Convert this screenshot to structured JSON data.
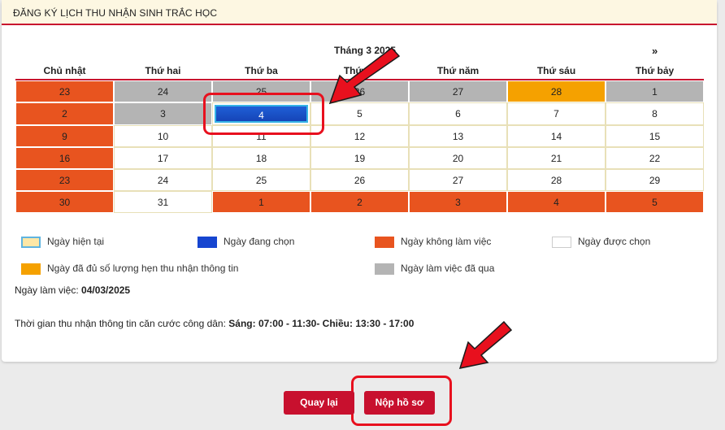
{
  "header": {
    "title": "ĐĂNG KÝ LỊCH THU NHẬN SINH TRẮC HỌC"
  },
  "calendar": {
    "month_title": "Tháng 3 2025",
    "next_label": "»",
    "weekdays": [
      "Chủ nhật",
      "Thứ hai",
      "Thứ ba",
      "Thứ tư",
      "Thứ năm",
      "Thứ sáu",
      "Thứ bảy"
    ],
    "weeks": [
      [
        {
          "d": "23",
          "t": "off"
        },
        {
          "d": "24",
          "t": "past"
        },
        {
          "d": "25",
          "t": "past"
        },
        {
          "d": "26",
          "t": "past"
        },
        {
          "d": "27",
          "t": "past"
        },
        {
          "d": "28",
          "t": "full"
        },
        {
          "d": "1",
          "t": "past"
        }
      ],
      [
        {
          "d": "2",
          "t": "off"
        },
        {
          "d": "3",
          "t": "past"
        },
        {
          "d": "4",
          "t": "sel"
        },
        {
          "d": "5",
          "t": "free"
        },
        {
          "d": "6",
          "t": "free"
        },
        {
          "d": "7",
          "t": "free"
        },
        {
          "d": "8",
          "t": "free"
        }
      ],
      [
        {
          "d": "9",
          "t": "off"
        },
        {
          "d": "10",
          "t": "free"
        },
        {
          "d": "11",
          "t": "free"
        },
        {
          "d": "12",
          "t": "free"
        },
        {
          "d": "13",
          "t": "free"
        },
        {
          "d": "14",
          "t": "free"
        },
        {
          "d": "15",
          "t": "free"
        }
      ],
      [
        {
          "d": "16",
          "t": "off"
        },
        {
          "d": "17",
          "t": "free"
        },
        {
          "d": "18",
          "t": "free"
        },
        {
          "d": "19",
          "t": "free"
        },
        {
          "d": "20",
          "t": "free"
        },
        {
          "d": "21",
          "t": "free"
        },
        {
          "d": "22",
          "t": "free"
        }
      ],
      [
        {
          "d": "23",
          "t": "off"
        },
        {
          "d": "24",
          "t": "free"
        },
        {
          "d": "25",
          "t": "free"
        },
        {
          "d": "26",
          "t": "free"
        },
        {
          "d": "27",
          "t": "free"
        },
        {
          "d": "28",
          "t": "free"
        },
        {
          "d": "29",
          "t": "free"
        }
      ],
      [
        {
          "d": "30",
          "t": "off"
        },
        {
          "d": "31",
          "t": "free"
        },
        {
          "d": "1",
          "t": "off"
        },
        {
          "d": "2",
          "t": "off"
        },
        {
          "d": "3",
          "t": "off"
        },
        {
          "d": "4",
          "t": "off"
        },
        {
          "d": "5",
          "t": "off"
        }
      ]
    ]
  },
  "legend": {
    "today": "Ngày hiện tại",
    "selecting": "Ngày đang chọn",
    "non_working": "Ngày không làm việc",
    "selectable": "Ngày được chọn",
    "full": "Ngày đã đủ số lượng hẹn thu nhận thông tin",
    "past": "Ngày làm việc đã qua"
  },
  "colors": {
    "accent": "#c8102e",
    "non_working": "#e8541f",
    "past": "#b4b4b4",
    "full": "#f5a100",
    "selected": "#1645b8",
    "today": "#fde7a6"
  },
  "info": {
    "workday_label": "Ngày làm việc: ",
    "workday_value": "04/03/2025",
    "hours_label": "Thời gian thu nhận thông tin căn cước công dân: ",
    "hours_value": "Sáng: 07:00 - 11:30- Chiều: 13:30 - 17:00"
  },
  "actions": {
    "back": "Quay lại",
    "submit": "Nộp hồ sơ"
  }
}
